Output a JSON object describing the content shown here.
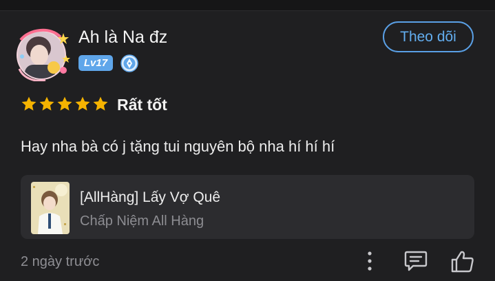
{
  "review": {
    "username": "Ah là Na đz",
    "level": "Lv17",
    "follow_label": "Theo dõi",
    "rating_stars": 5,
    "rating_label": "Rất tốt",
    "comment": "Hay nha bà có j tặng tui nguyên bộ nha hí hí hí",
    "timestamp": "2 ngày trước"
  },
  "book": {
    "title": "[AllHàng] Lấy Vợ Quê",
    "author": "Chấp Niệm All Hàng"
  },
  "colors": {
    "background": "#1f1f21",
    "accent": "#5aa0e6",
    "star": "#f5b301",
    "card": "#2c2c2f"
  },
  "icons": {
    "more": "more-vertical-icon",
    "reply": "comment-icon",
    "like": "thumbs-up-icon",
    "star": "star-icon",
    "pen": "pen-badge-icon"
  }
}
